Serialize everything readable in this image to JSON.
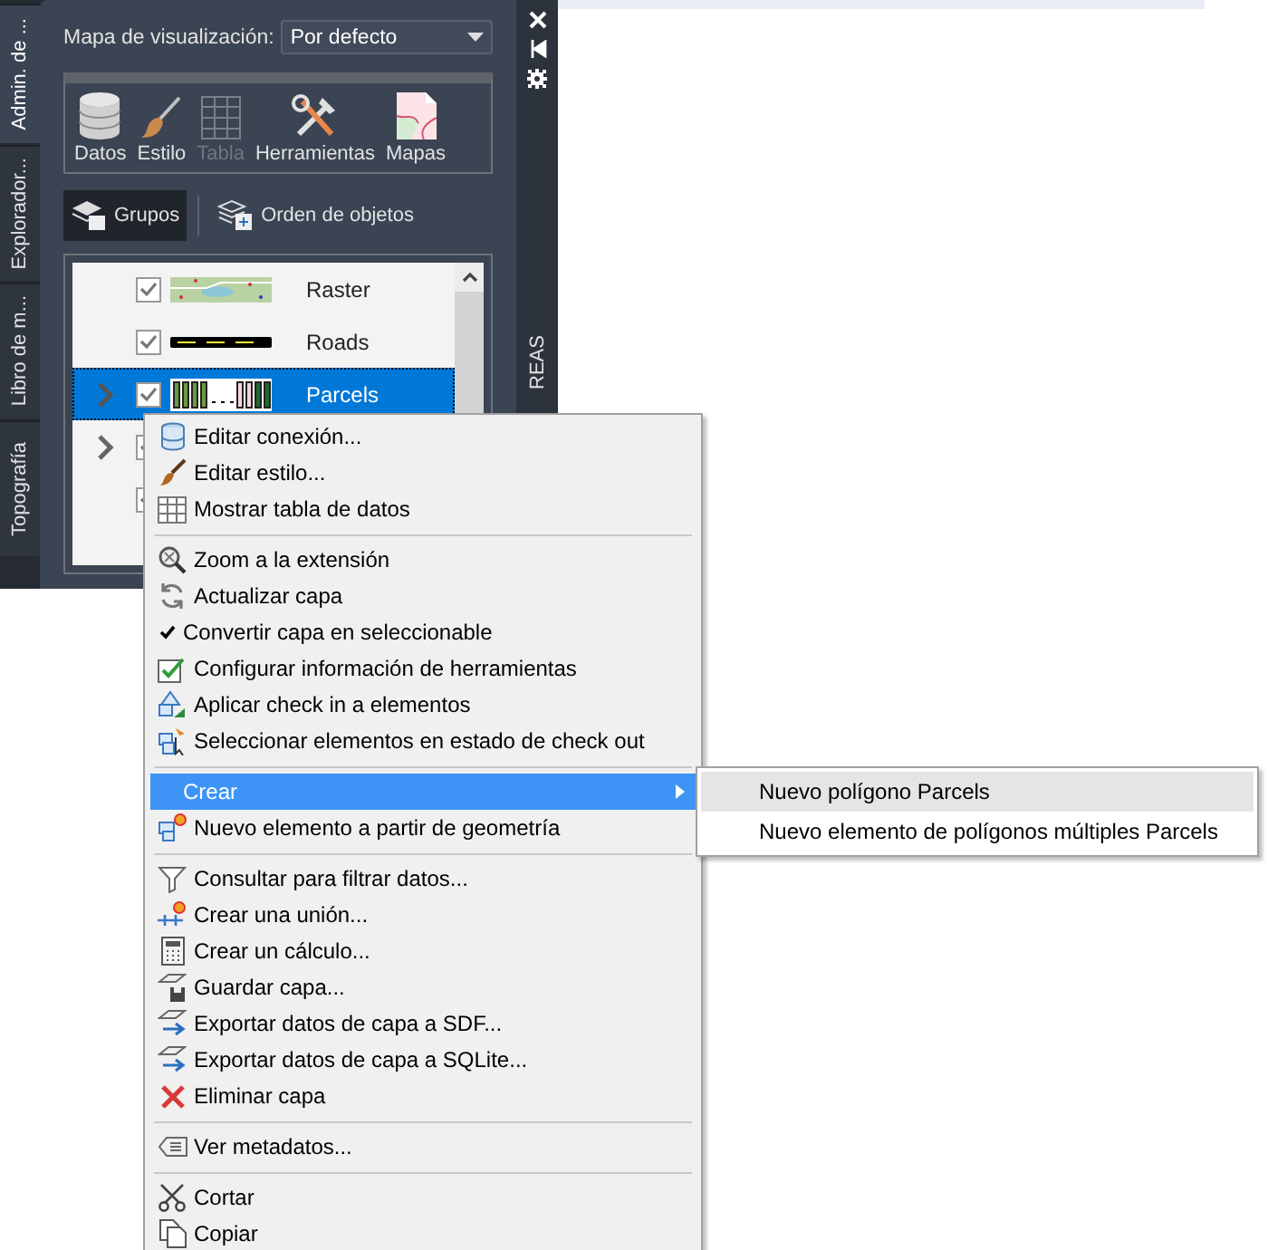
{
  "palette": {
    "tabs": [
      {
        "label": "Admin. de ...",
        "selected": true
      },
      {
        "label": "Explorador...",
        "selected": false
      },
      {
        "label": "Libro de m...",
        "selected": false
      },
      {
        "label": "Topografía",
        "selected": false
      }
    ],
    "side_title": "REAS",
    "display_map": {
      "label": "Mapa de visualización:",
      "value": "Por defecto"
    },
    "toolbar": [
      {
        "label": "Datos",
        "disabled": false
      },
      {
        "label": "Estilo",
        "disabled": false
      },
      {
        "label": "Tabla",
        "disabled": true
      },
      {
        "label": "Herramientas",
        "disabled": false
      },
      {
        "label": "Mapas",
        "disabled": false
      }
    ],
    "view_buttons": [
      {
        "label": "Grupos",
        "selected": true
      },
      {
        "label": "Orden de objetos",
        "selected": false
      }
    ],
    "layers": [
      {
        "name": "Raster",
        "checked": true,
        "expandable": false,
        "selected": false
      },
      {
        "name": "Roads",
        "checked": true,
        "expandable": false,
        "selected": false
      },
      {
        "name": "Parcels",
        "checked": true,
        "expandable": true,
        "selected": true
      },
      {
        "checked": true,
        "expandable": true,
        "selected": false
      },
      {
        "checked": true,
        "expandable": false,
        "selected": false
      }
    ]
  },
  "context_menu": {
    "items": [
      {
        "kind": "item",
        "label": "Editar conexión...",
        "checked": false,
        "selected": false
      },
      {
        "kind": "item",
        "label": "Editar estilo...",
        "checked": false,
        "selected": false
      },
      {
        "kind": "item",
        "label": "Mostrar tabla de datos",
        "checked": false,
        "selected": false
      },
      {
        "kind": "separator"
      },
      {
        "kind": "item",
        "label": "Zoom a la extensión",
        "checked": false,
        "selected": false
      },
      {
        "kind": "item",
        "label": "Actualizar capa",
        "checked": false,
        "selected": false
      },
      {
        "kind": "item",
        "label": "Convertir capa en seleccionable",
        "checked": true,
        "selected": false
      },
      {
        "kind": "item",
        "label": "Configurar información de herramientas",
        "checked": false,
        "selected": false
      },
      {
        "kind": "item",
        "label": "Aplicar check in a elementos",
        "checked": false,
        "selected": false
      },
      {
        "kind": "item",
        "label": "Seleccionar elementos en estado de check out",
        "checked": false,
        "selected": false
      },
      {
        "kind": "separator"
      },
      {
        "kind": "submenu",
        "label": "Crear",
        "checked": false,
        "selected": true
      },
      {
        "kind": "item",
        "label": "Nuevo elemento a partir de geometría",
        "checked": false,
        "selected": false
      },
      {
        "kind": "separator"
      },
      {
        "kind": "item",
        "label": "Consultar para filtrar datos...",
        "checked": false,
        "selected": false
      },
      {
        "kind": "item",
        "label": "Crear una unión...",
        "checked": false,
        "selected": false
      },
      {
        "kind": "item",
        "label": "Crear un cálculo...",
        "checked": false,
        "selected": false
      },
      {
        "kind": "item",
        "label": "Guardar capa...",
        "checked": false,
        "selected": false
      },
      {
        "kind": "item",
        "label": "Exportar datos de capa a SDF...",
        "checked": false,
        "selected": false
      },
      {
        "kind": "item",
        "label": "Exportar datos de capa a SQLite...",
        "checked": false,
        "selected": false
      },
      {
        "kind": "item",
        "label": "Eliminar capa",
        "checked": false,
        "selected": false
      },
      {
        "kind": "separator"
      },
      {
        "kind": "item",
        "label": "Ver metadatos...",
        "checked": false,
        "selected": false
      },
      {
        "kind": "separator"
      },
      {
        "kind": "item",
        "label": "Cortar",
        "checked": false,
        "selected": false
      },
      {
        "kind": "item",
        "label": "Copiar",
        "checked": false,
        "selected": false
      }
    ]
  },
  "submenu": {
    "items": [
      {
        "label": "Nuevo polígono Parcels",
        "selected": true
      },
      {
        "label": "Nuevo elemento de polígonos múltiples Parcels",
        "selected": false
      }
    ]
  }
}
